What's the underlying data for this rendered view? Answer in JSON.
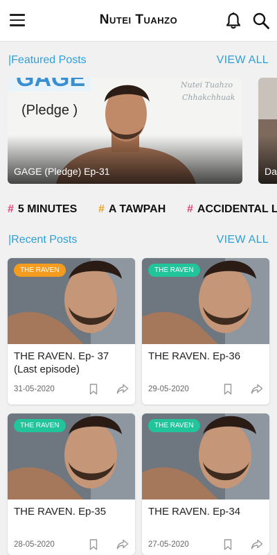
{
  "appbar": {
    "title": "Nutei Tuahzo"
  },
  "featured": {
    "heading": "|Featured Posts",
    "view_all": "VIEW ALL",
    "cards": [
      {
        "caption": "GAGE (Pledge) Ep-31",
        "art_title": "(Pledge )",
        "art_big": "GAGE",
        "watermark_1": "Nutei Tuahzo",
        "watermark_2": "Chhakchhuak"
      },
      {
        "caption": "Da"
      }
    ]
  },
  "tags": [
    {
      "label": "5 MINUTES",
      "hash": "#",
      "hash_color": "#e5427a"
    },
    {
      "label": "A TAWPAH",
      "hash": "#",
      "hash_color": "#f3a123"
    },
    {
      "label": "ACCIDENTAL LO",
      "hash": "#",
      "hash_color": "#e5427a"
    }
  ],
  "recent": {
    "heading": "|Recent Posts",
    "view_all": "VIEW ALL",
    "posts": [
      {
        "badge": "THE RAVEN",
        "badge_color": "#f39c1f",
        "title": "THE RAVEN. Ep- 37 (Last episode)",
        "date": "31-05-2020"
      },
      {
        "badge": "THE RAVEN",
        "badge_color": "#22c49b",
        "title": "THE RAVEN. Ep-36",
        "date": "29-05-2020"
      },
      {
        "badge": "THE RAVEN",
        "badge_color": "#22c49b",
        "title": "THE RAVEN. Ep-35",
        "date": "28-05-2020"
      },
      {
        "badge": "THE RAVEN",
        "badge_color": "#22c49b",
        "title": "THE RAVEN. Ep-34",
        "date": "27-05-2020"
      }
    ]
  },
  "colors": {
    "accent": "#2f9fd8",
    "background": "#f1f1f1"
  },
  "icons": {
    "menu": "hamburger-menu-icon",
    "bell": "bell-icon",
    "search": "search-icon",
    "bookmark": "bookmark-icon",
    "share": "share-icon"
  }
}
